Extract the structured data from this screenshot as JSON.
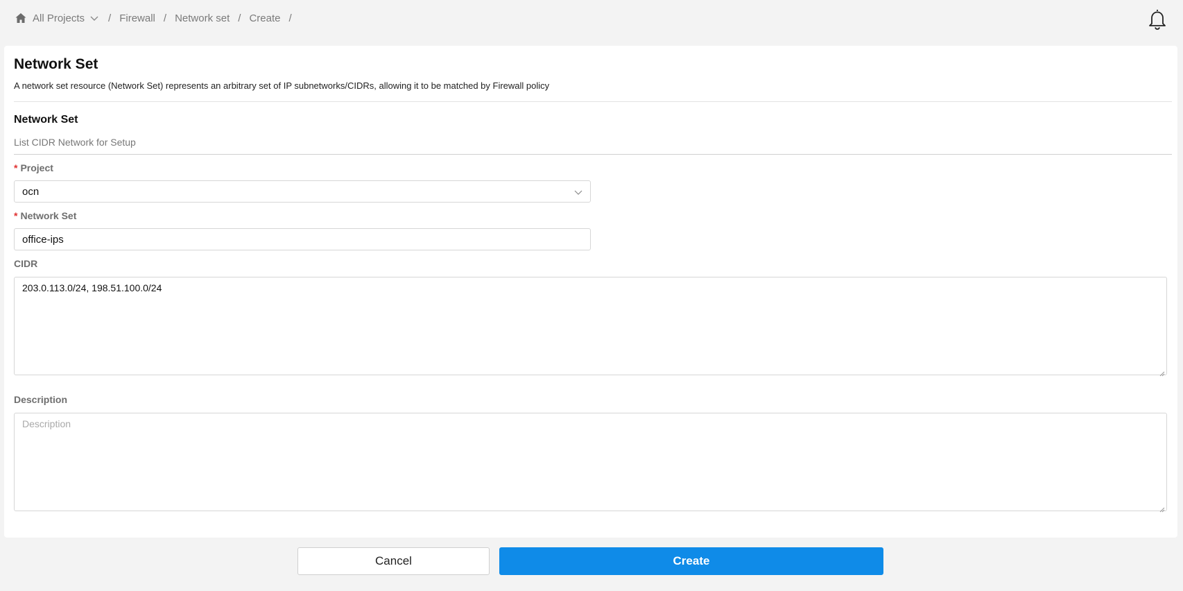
{
  "breadcrumb": {
    "items": [
      "All Projects",
      "Firewall",
      "Network set",
      "Create"
    ],
    "separator": "/"
  },
  "icons": {
    "home": "home-icon",
    "dropdown": "chevron-down-icon",
    "notifications": "bell-icon"
  },
  "page": {
    "title": "Network Set",
    "description": "A network set resource (Network Set) represents an arbitrary set of IP subnetworks/CIDRs, allowing it to be matched by Firewall policy"
  },
  "section": {
    "title": "Network Set",
    "subtitle": "List CIDR Network for Setup"
  },
  "form": {
    "required_marker": "*",
    "project": {
      "label": "Project",
      "value": "ocn"
    },
    "network_set": {
      "label": "Network Set",
      "value": "office-ips"
    },
    "cidr": {
      "label": "CIDR",
      "value": "203.0.113.0/24, 198.51.100.0/24"
    },
    "description": {
      "label": "Description",
      "value": "",
      "placeholder": "Description"
    }
  },
  "actions": {
    "cancel_label": "Cancel",
    "create_label": "Create"
  },
  "colors": {
    "primary": "#0f8be8",
    "required": "#e03131",
    "background": "#f3f3f3"
  }
}
